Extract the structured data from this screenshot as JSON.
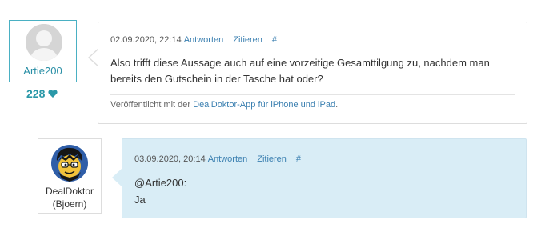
{
  "posts": [
    {
      "author": "Artie200",
      "likes": "228",
      "date": "02.09.2020, 22:14",
      "reply_label": "Antworten",
      "quote_label": "Zitieren",
      "permalink_label": "#",
      "body": "Also trifft diese Aussage auch auf eine vorzeitige Gesamttilgung zu, nachdem man bereits den Gutschein in der Tasche hat oder?",
      "signature_prefix": "Veröffentlicht mit der ",
      "signature_link": "DealDoktor-App für iPhone und iPad",
      "signature_suffix": "."
    },
    {
      "author_line1": "DealDoktor",
      "author_line2": "(Bjoern)",
      "date": "03.09.2020, 20:14",
      "reply_label": "Antworten",
      "quote_label": "Zitieren",
      "permalink_label": "#",
      "mention": "@Artie200:",
      "body": "Ja"
    }
  ],
  "colors": {
    "accent": "#2a98a8",
    "link": "#3a7fb0",
    "highlight_bg": "#d9edf6"
  },
  "icons": {
    "likes": "heart-icon",
    "default_avatar": "user-silhouette-icon",
    "custom_avatar": "cartoon-face-avatar"
  }
}
